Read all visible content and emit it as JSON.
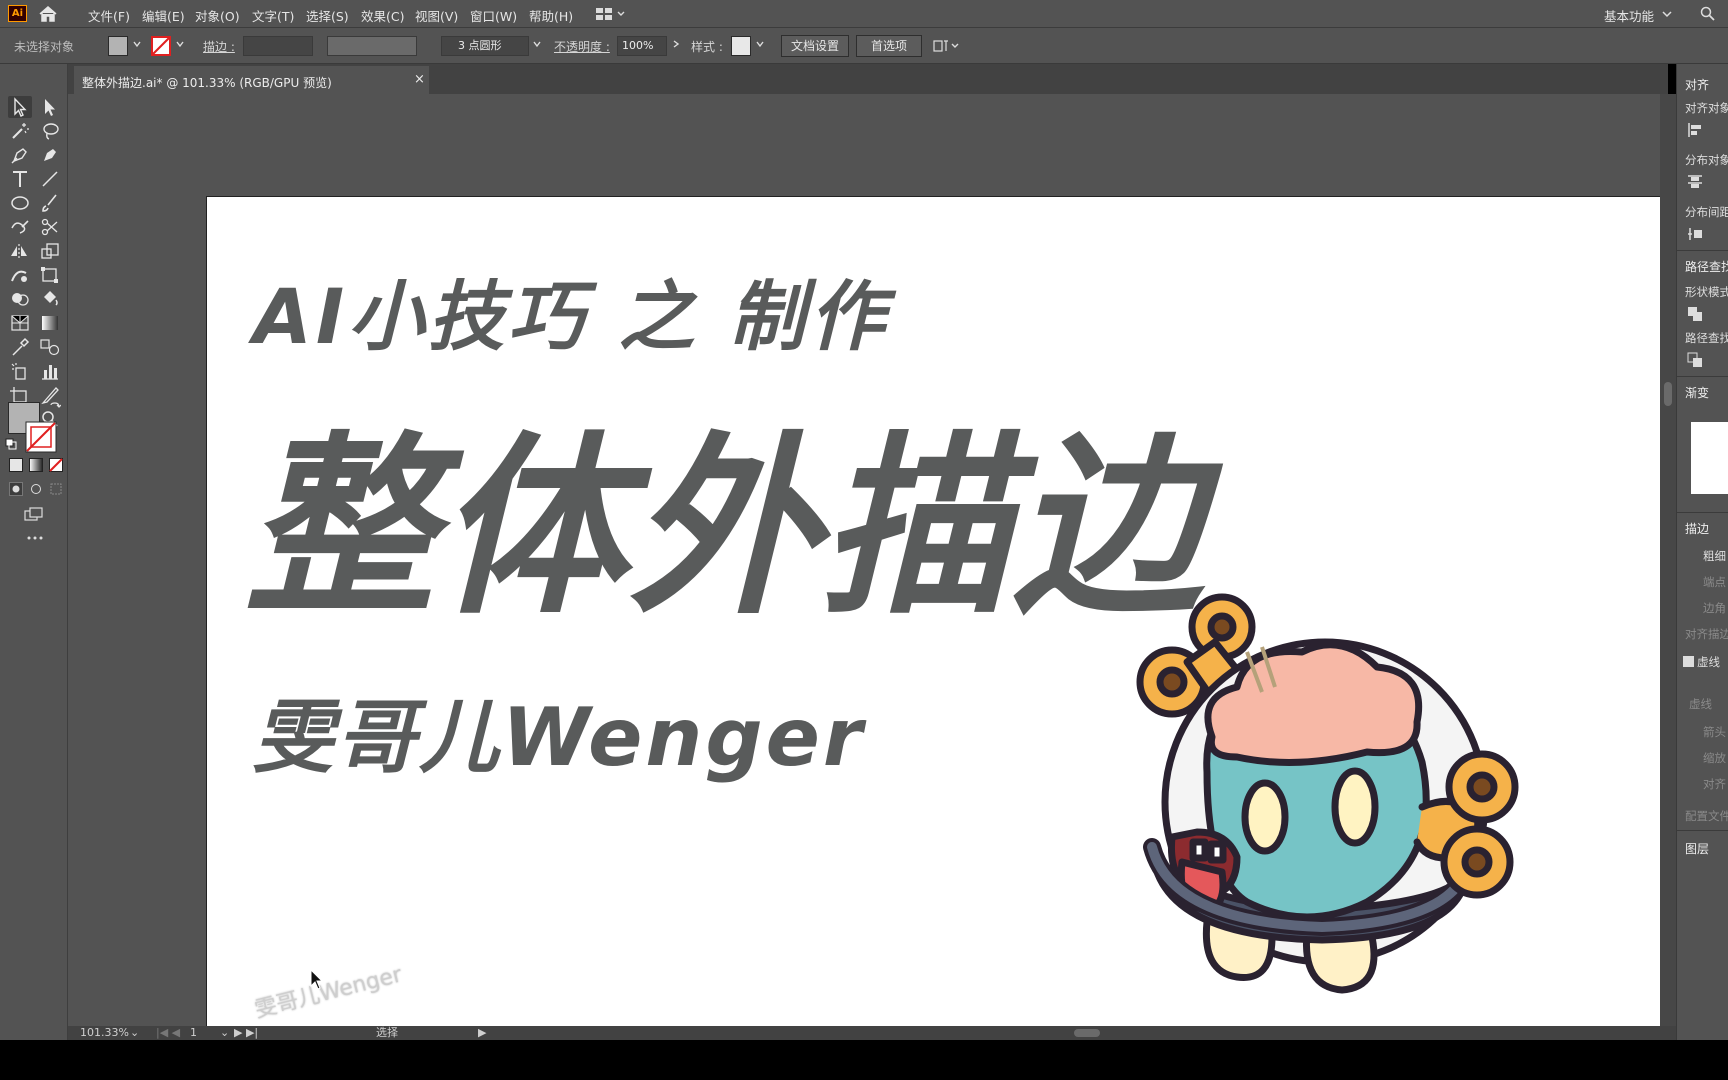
{
  "app": {
    "logo": "Ai",
    "menus": [
      "文件(F)",
      "编辑(E)",
      "对象(O)",
      "文字(T)",
      "选择(S)",
      "效果(C)",
      "视图(V)",
      "窗口(W)",
      "帮助(H)"
    ],
    "workspace": "基本功能",
    "search_icon": "search-icon"
  },
  "control_bar": {
    "selection_status": "未选择对象",
    "stroke_label": "描边 :",
    "brush_value": "3 点圆形",
    "opacity_label": "不透明度 :",
    "opacity_value": "100%",
    "style_label": "样式 :",
    "doc_setup_button": "文档设置",
    "preferences_button": "首选项",
    "fill_color": "#b3b3b3",
    "stroke_color": "#e02020"
  },
  "document": {
    "tab_title": "整体外描边.ai* @ 101.33% (RGB/GPU 预览)",
    "close_glyph": "×"
  },
  "artwork": {
    "line1": "AI小技巧 之 制作",
    "line2": "整体外描边",
    "line3": "雯哥儿Wenger",
    "text_color": "#595b5b",
    "watermark": "雯哥儿Wenger"
  },
  "right_panel": {
    "align_title": "对齐",
    "align_objects": "对齐对象",
    "distribute_objects": "分布对象",
    "distribute_spacing": "分布间距",
    "pathfinder_title": "路径查找器",
    "shape_modes": "形状模式",
    "pathfinders": "路径查找",
    "gradient_title": "渐变",
    "stroke_title": "描边",
    "stroke_weight": "粗细",
    "cap": "端点",
    "corner": "边角",
    "align_stroke": "对齐描边",
    "dashed_line": "虚线",
    "dash": "虚线",
    "arrowheads": "箭头",
    "scale": "缩放",
    "align": "对齐",
    "profile": "配置文件",
    "layers_title": "图层"
  },
  "status_bar": {
    "zoom": "101.33%",
    "artboard_number": "1",
    "tool_status": "选择"
  }
}
